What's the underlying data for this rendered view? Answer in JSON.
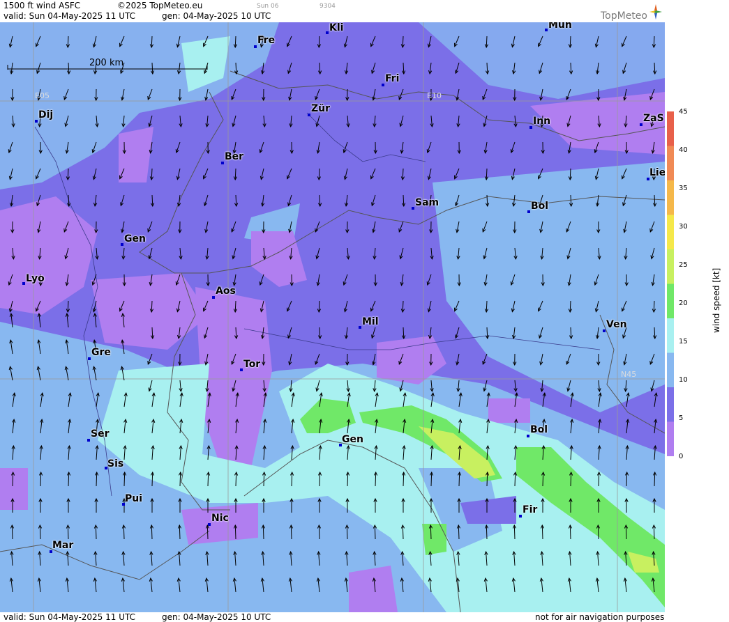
{
  "header": {
    "product": "1500 ft wind ASFC",
    "copyright": "©2025 TopMeteo.eu",
    "nav_day": "Sun 06",
    "nav_code": "9304",
    "valid": "valid:  Sun  04-May-2025  11 UTC",
    "gen": "gen: 04-May-2025 10 UTC",
    "logo": "TopMeteo"
  },
  "footer": {
    "valid": "valid:  Sun  04-May-2025  11 UTC",
    "gen": "gen: 04-May-2025 10 UTC",
    "disclaimer": "not for air navigation purposes"
  },
  "scale_label": "200 km",
  "grid_labels": {
    "e05": "E05",
    "e10": "E10",
    "n45": "N45"
  },
  "cities": [
    {
      "name": "Kli"
    },
    {
      "name": "Mün"
    },
    {
      "name": "Fre"
    },
    {
      "name": "Fri"
    },
    {
      "name": "Dij"
    },
    {
      "name": "Zür"
    },
    {
      "name": "Inn"
    },
    {
      "name": "ZaS"
    },
    {
      "name": "Ber"
    },
    {
      "name": "Lie"
    },
    {
      "name": "Sam"
    },
    {
      "name": "Bol"
    },
    {
      "name": "Gen"
    },
    {
      "name": "Lyo"
    },
    {
      "name": "Aos"
    },
    {
      "name": "Mil"
    },
    {
      "name": "Ven"
    },
    {
      "name": "Gre"
    },
    {
      "name": "Tor"
    },
    {
      "name": "Ser"
    },
    {
      "name": "Gen"
    },
    {
      "name": "Bol"
    },
    {
      "name": "Sis"
    },
    {
      "name": "Pui"
    },
    {
      "name": "Fir"
    },
    {
      "name": "Nic"
    },
    {
      "name": "Mar"
    }
  ],
  "legend": {
    "title": "wind speed [kt]",
    "ticks": [
      "45",
      "40",
      "35",
      "30",
      "25",
      "20",
      "15",
      "10",
      "5",
      "0"
    ],
    "colors": [
      "#e8604a",
      "#f08a55",
      "#f5b84a",
      "#f5e84a",
      "#c8f060",
      "#70e868",
      "#a8f0f0",
      "#88b8f0",
      "#7b6fe8",
      "#b07ef0"
    ]
  },
  "colors": {
    "calm_violet": "#b07ef0",
    "light_wind_purple": "#7b6fe8",
    "moderate_blue": "#88b8f0",
    "fresh_cyan": "#a8f0f0",
    "strong_green": "#70e868"
  }
}
